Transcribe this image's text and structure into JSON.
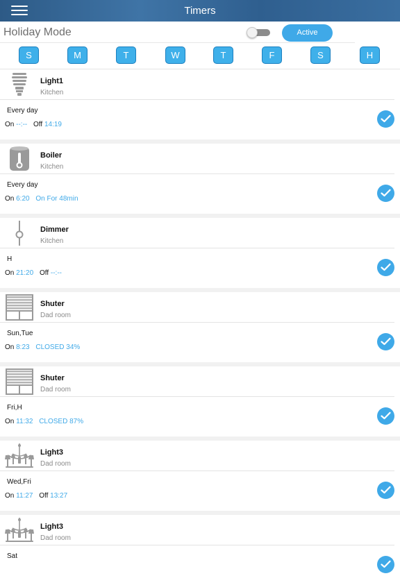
{
  "header": {
    "title": "Timers",
    "menu_icon": "hamburger-icon"
  },
  "holiday": {
    "label": "Holiday Mode",
    "toggle_on": false,
    "active_label": "Active"
  },
  "days": [
    "S",
    "M",
    "T",
    "W",
    "T",
    "F",
    "S",
    "H"
  ],
  "colors": {
    "accent": "#3fa9e8",
    "header": "#2d5a86"
  },
  "timers": [
    {
      "icon": "bulb-icon",
      "name": "Light1",
      "room": "Kitchen",
      "days": "Every day",
      "a_label": "On",
      "a_value": "--:--",
      "b_label": "Off",
      "b_value": "14:19"
    },
    {
      "icon": "boiler-icon",
      "name": "Boiler",
      "room": "Kitchen",
      "days": "Every day",
      "a_label": "On",
      "a_value": "6:20",
      "b_label": "",
      "b_value": "On For 48min"
    },
    {
      "icon": "dimmer-icon",
      "name": "Dimmer",
      "room": "Kitchen",
      "days": "H",
      "a_label": "On",
      "a_value": "21:20",
      "b_label": "Off",
      "b_value": "--:--"
    },
    {
      "icon": "shutter-icon",
      "name": "Shuter",
      "room": "Dad room",
      "days": "Sun,Tue",
      "a_label": "On",
      "a_value": "8:23",
      "b_label": "",
      "b_value": "CLOSED 34%"
    },
    {
      "icon": "shutter-icon",
      "name": "Shuter",
      "room": "Dad room",
      "days": "Fri,H",
      "a_label": "On",
      "a_value": "11:32",
      "b_label": "",
      "b_value": "CLOSED 87%"
    },
    {
      "icon": "chandelier-icon",
      "name": "Light3",
      "room": "Dad room",
      "days": "Wed,Fri",
      "a_label": "On",
      "a_value": "11:27",
      "b_label": "Off",
      "b_value": "13:27"
    },
    {
      "icon": "chandelier-icon",
      "name": "Light3",
      "room": "Dad room",
      "days": "Sat",
      "a_label": "",
      "a_value": "",
      "b_label": "",
      "b_value": ""
    }
  ]
}
